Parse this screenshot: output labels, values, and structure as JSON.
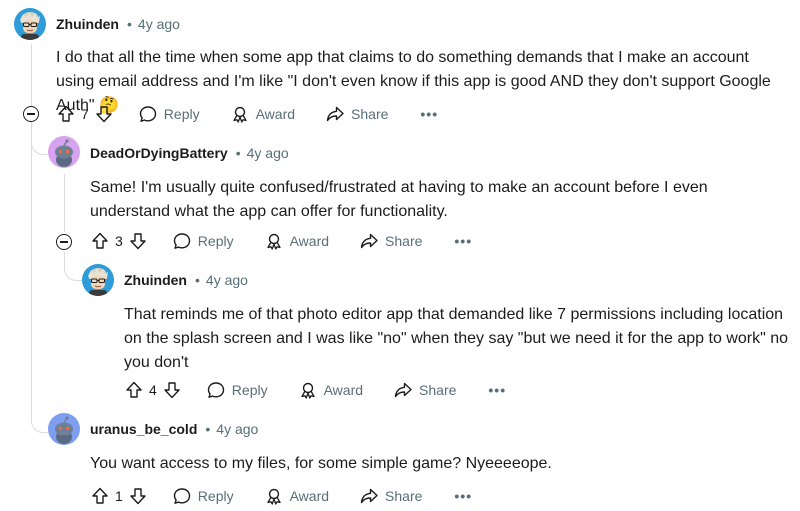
{
  "colors": {
    "author": "#1c1c1c",
    "muted": "#576f76",
    "thread_line": "#d9dcdf",
    "avatar_purple": "#d7a3f1",
    "avatar_blue": "#7f9ef0"
  },
  "comments": [
    {
      "author": "Zhuinden",
      "separator": "•",
      "time": "4y ago",
      "body": "I do that all the time when some app that claims to do something demands that I make an account using email address and I'm like \"I don't even know if this app is good AND they don't support Google Auth\" 🤔",
      "votes": "7",
      "reply": "Reply",
      "award": "Award",
      "share": "Share",
      "more": "•••"
    },
    {
      "author": "DeadOrDyingBattery",
      "separator": "•",
      "time": "4y ago",
      "body": "Same! I'm usually quite confused/frustrated at having to make an account before I even understand what the app can offer for functionality.",
      "votes": "3",
      "reply": "Reply",
      "award": "Award",
      "share": "Share",
      "more": "•••"
    },
    {
      "author": "Zhuinden",
      "separator": "•",
      "time": "4y ago",
      "body": "That reminds me of that photo editor app that demanded like 7 permissions including location on the splash screen and I was like \"no\" when they say \"but we need it for the app to work\" no you don't",
      "votes": "4",
      "reply": "Reply",
      "award": "Award",
      "share": "Share",
      "more": "•••"
    },
    {
      "author": "uranus_be_cold",
      "separator": "•",
      "time": "4y ago",
      "body": "You want access to my files, for some simple game? Nyeeeeope.",
      "votes": "1",
      "reply": "Reply",
      "award": "Award",
      "share": "Share",
      "more": "•••"
    }
  ]
}
